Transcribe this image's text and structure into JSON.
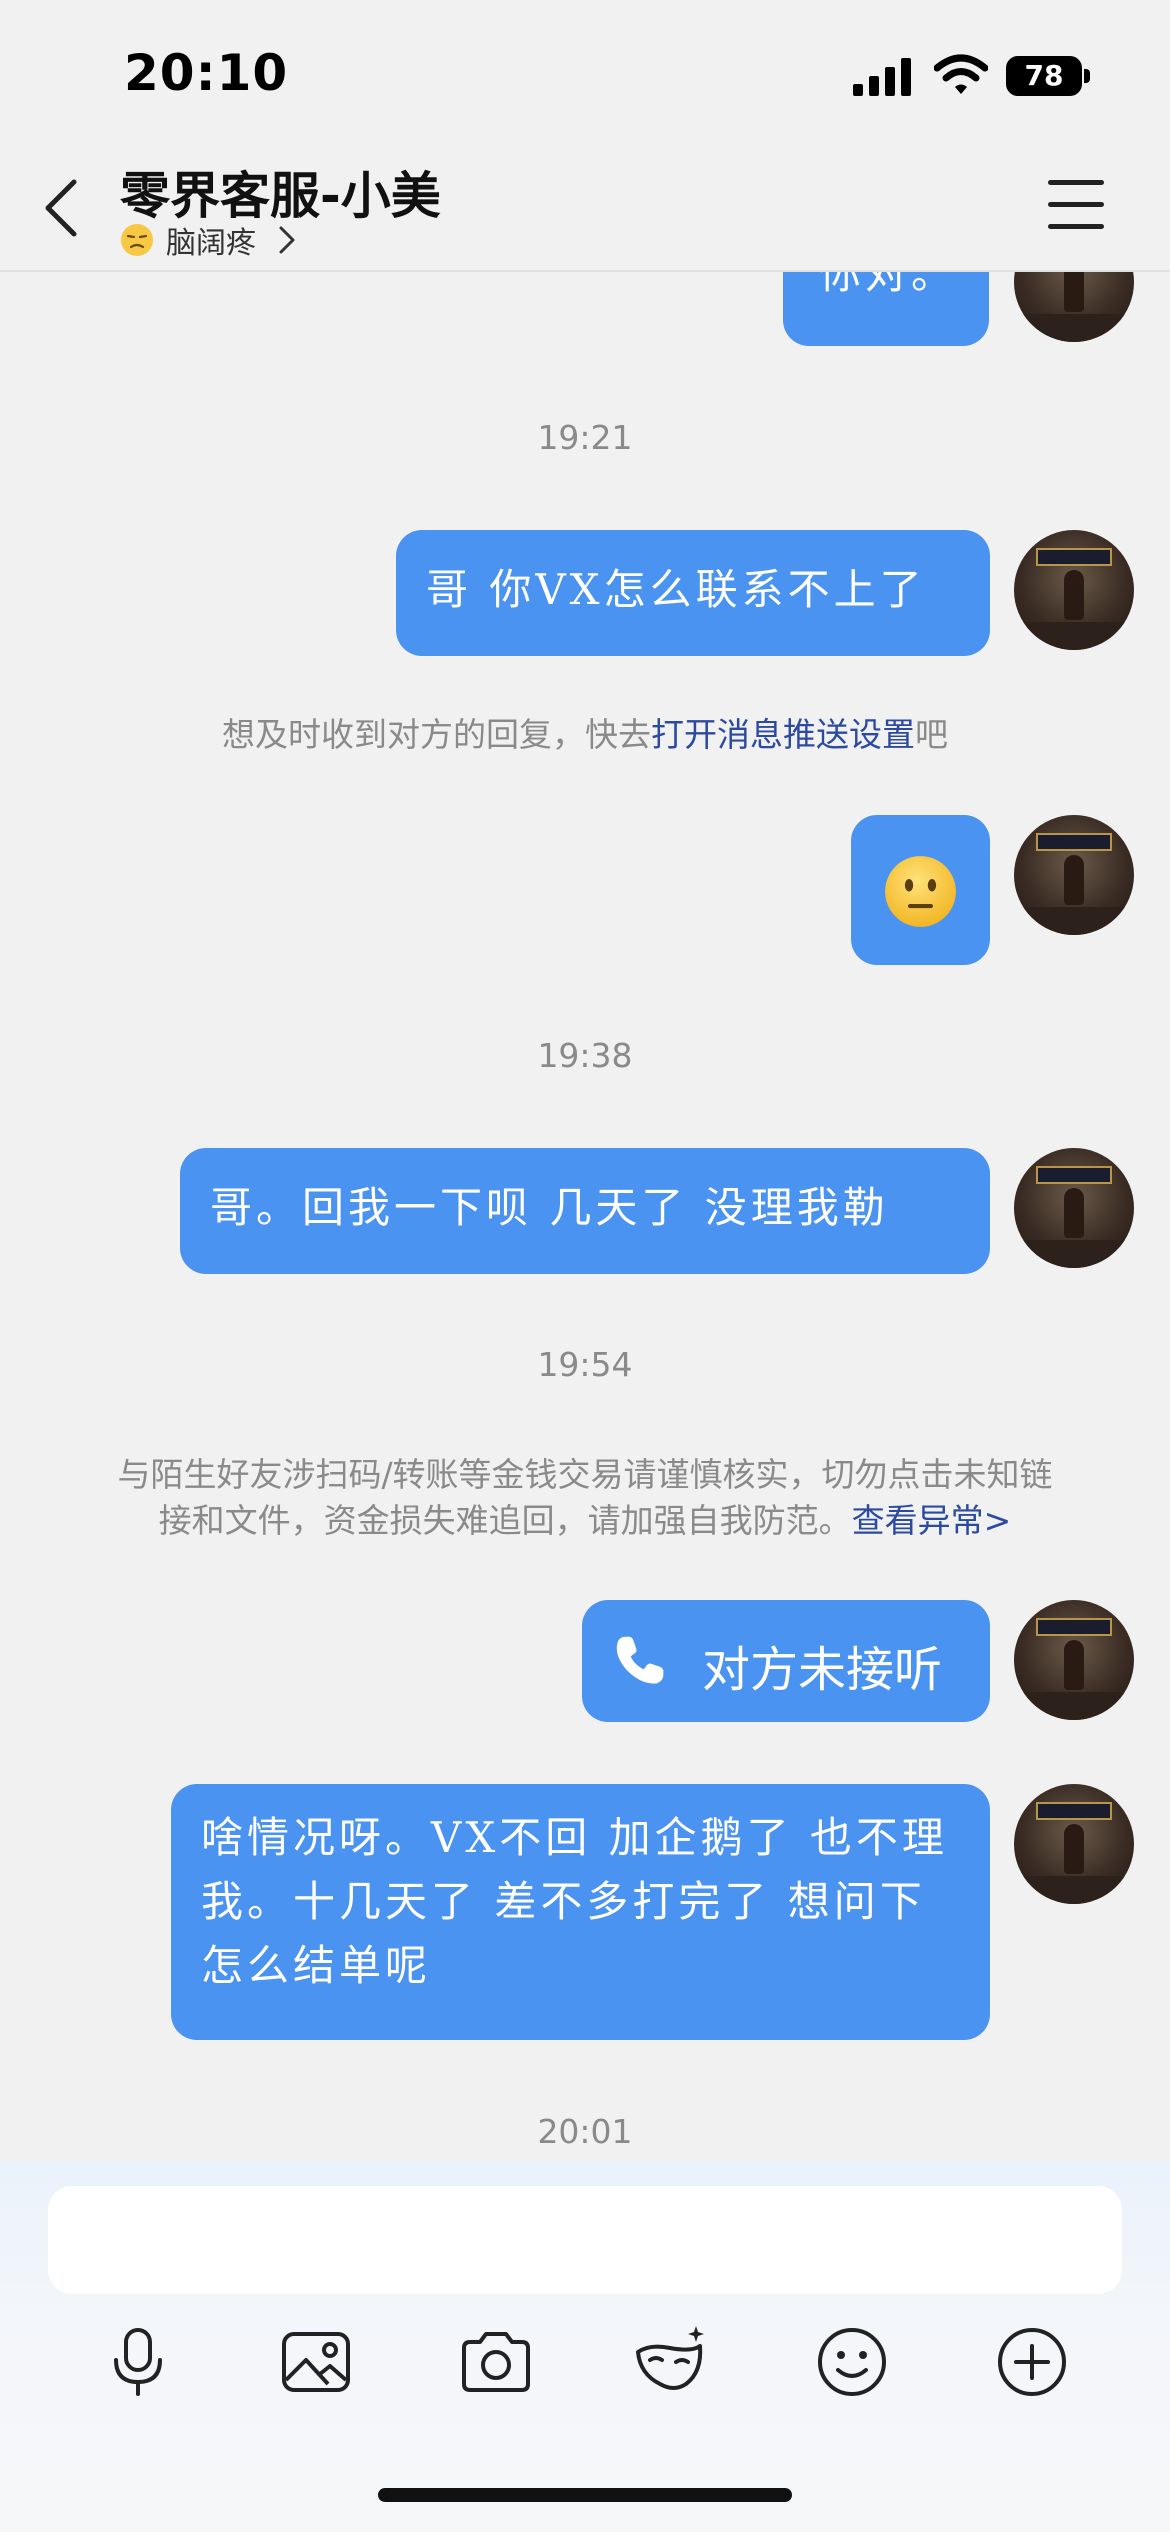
{
  "status_bar": {
    "time": "20:10",
    "battery": "78"
  },
  "header": {
    "title": "零界客服-小美",
    "status": "脑阔疼"
  },
  "messages": {
    "m0_text": "你对。",
    "ts1": "19:21",
    "m1_text": "哥 你VX怎么联系不上了",
    "sys_push_prefix": "想及时收到对方的回复，快去",
    "sys_push_link": "打开消息推送设置",
    "sys_push_suffix": "吧",
    "ts2": "19:38",
    "m3_text": "哥。回我一下呗 几天了 没理我勒",
    "ts3": "19:54",
    "sys_warn_line1": "与陌生好友涉扫码/转账等金钱交易请谨慎核实，切勿点击未知链",
    "sys_warn_line2": "接和文件，资金损失难追回，请加强自我防范。",
    "sys_warn_link": "查看异常>",
    "call_text": "对方未接听",
    "m5_text": "啥情况呀。VX不回 加企鹅了 也不理我。十几天了 差不多打完了 想问下怎么结单呢",
    "ts4": "20:01"
  },
  "composer": {
    "placeholder": ""
  },
  "colors": {
    "bubble": "#4a93f0",
    "background": "#f1f1f1",
    "link": "#2c4aa0"
  }
}
